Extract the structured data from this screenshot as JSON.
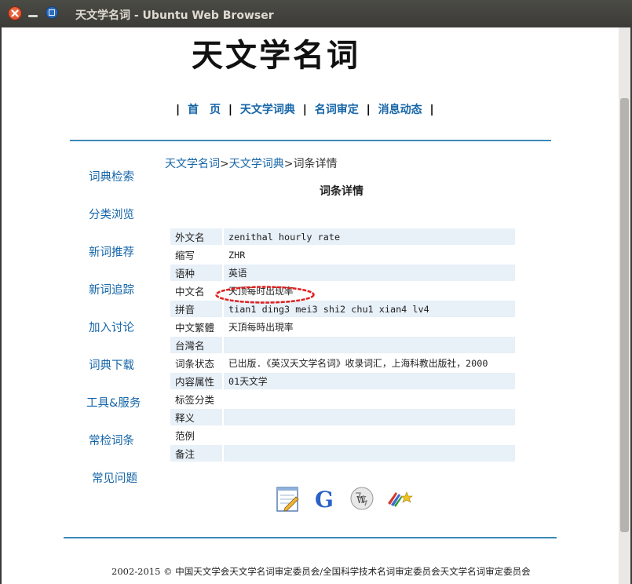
{
  "window": {
    "title": "天文学名词 - Ubuntu Web Browser"
  },
  "site": {
    "logo_text": "天文学名词"
  },
  "topnav": {
    "separator": "|",
    "items": [
      "首　页",
      "天文学词典",
      "名词审定",
      "消息动态"
    ]
  },
  "sidebar": {
    "items": [
      "词典检索",
      "分类浏览",
      "新词推荐",
      "新词追踪",
      "加入讨论",
      "词典下载",
      "工具&服务",
      "常检词条",
      "常见问题"
    ]
  },
  "breadcrumb": {
    "items": [
      "天文学名词",
      "天文学词典",
      "词条详情"
    ],
    "separator": ">"
  },
  "heading": "词条详情",
  "details": {
    "rows": [
      {
        "label": "外文名",
        "value": "zenithal hourly rate"
      },
      {
        "label": "缩写",
        "value": "ZHR"
      },
      {
        "label": "语种",
        "value": "英语"
      },
      {
        "label": "中文名",
        "value": "天顶每时出现率"
      },
      {
        "label": "拼音",
        "value": "tian1 ding3 mei3 shi2 chu1 xian4 lv4"
      },
      {
        "label": "中文繁體",
        "value": "天頂每時出現率"
      },
      {
        "label": "台灣名",
        "value": ""
      },
      {
        "label": "词条状态",
        "value": "已出版.《英汉天文学名词》收录词汇，上海科教出版社，2000"
      },
      {
        "label": "内容属性",
        "value": "01天文学"
      },
      {
        "label": "标签分类",
        "value": ""
      },
      {
        "label": "释义",
        "value": ""
      },
      {
        "label": "范例",
        "value": ""
      },
      {
        "label": "备注",
        "value": ""
      }
    ]
  },
  "search_icons": [
    "notepad-icon",
    "google-icon",
    "wikipedia-icon",
    "books-star-icon"
  ],
  "footer": "2002-2015 © 中国天文学会天文学名词审定委员会/全国科学技术名词审定委员会天文学名词审定委员会",
  "colors": {
    "link": "#1565a8",
    "rule": "#3c89b8",
    "row_shade": "#e8f0f8",
    "highlight": "#e02020"
  }
}
